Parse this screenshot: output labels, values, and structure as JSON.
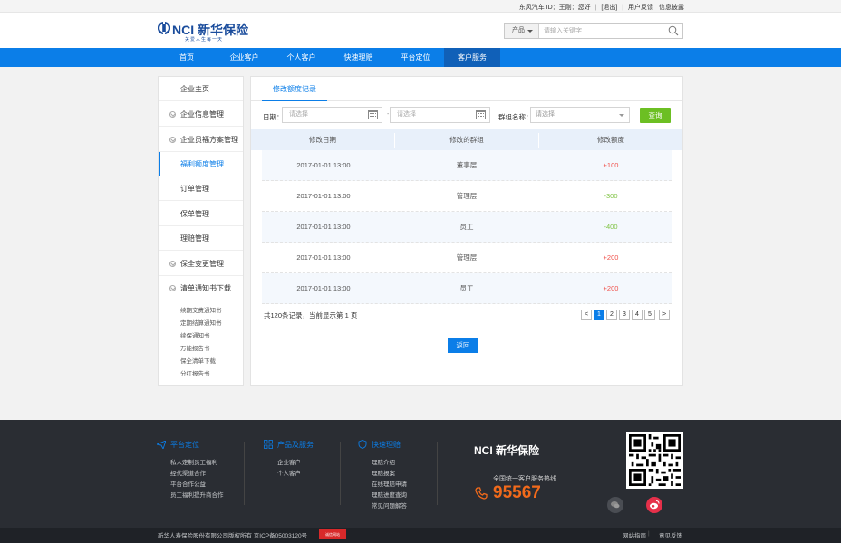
{
  "topbar": {
    "user_greeting": "东风汽车   ID：王刚：您好",
    "logout": "[退出]",
    "feedback": "用户反馈",
    "info_disclosure": "信息披露"
  },
  "header": {
    "logo_text": "NCI 新华保险",
    "logo_slogan": "关爱人生每一天",
    "search": {
      "category": "产品",
      "placeholder": "请输入关键字"
    }
  },
  "nav": {
    "items": [
      "首页",
      "企业客户",
      "个人客户",
      "快速理赔",
      "平台定位",
      "客户服务"
    ],
    "active": "客户服务"
  },
  "sidebar": {
    "items": [
      {
        "label": "企业主页",
        "expandable": false
      },
      {
        "label": "企业信息管理",
        "expandable": true
      },
      {
        "label": "企业员福方案管理",
        "expandable": true
      },
      {
        "label": "福利额度管理",
        "expandable": false,
        "active": true
      },
      {
        "label": "订单管理",
        "expandable": false
      },
      {
        "label": "保单管理",
        "expandable": false
      },
      {
        "label": "理赔管理",
        "expandable": false
      },
      {
        "label": "保全变更管理",
        "expandable": true
      },
      {
        "label": "清单通知书下载",
        "expandable": true
      }
    ],
    "subitems": [
      "续期交费通知书",
      "定期结算通知书",
      "续保通知书",
      "万能报告书",
      "保全清单下载",
      "分红报告书"
    ]
  },
  "panel": {
    "tab": "修改额度记录",
    "filter": {
      "date_label": "日期：",
      "date_start_placeholder": "请选择",
      "date_end_placeholder": "请选择",
      "group_label": "群组名称：",
      "group_placeholder": "请选择",
      "query_button": "查询"
    },
    "table": {
      "headers": [
        "修改日期",
        "修改的群组",
        "修改额度"
      ],
      "rows": [
        {
          "date": "2017-01-01 13:00",
          "group": "董事层",
          "amount": "+100",
          "type": "plus"
        },
        {
          "date": "2017-01-01 13:00",
          "group": "管理层",
          "amount": "-300",
          "type": "minus"
        },
        {
          "date": "2017-01-01 13:00",
          "group": "员工",
          "amount": "-400",
          "type": "minus"
        },
        {
          "date": "2017-01-01 13:00",
          "group": "管理层",
          "amount": "+200",
          "type": "plus"
        },
        {
          "date": "2017-01-01 13:00",
          "group": "员工",
          "amount": "+200",
          "type": "plus"
        }
      ]
    },
    "pager": {
      "info": "共120条记录，当前显示第 1 页",
      "prev": "<",
      "pages": [
        "1",
        "2",
        "3",
        "4",
        "5"
      ],
      "current": "1",
      "next": ">"
    },
    "back_button": "返回"
  },
  "footer": {
    "columns": [
      {
        "title": "平台定位",
        "icon": "send-icon",
        "items": [
          "私人定制员工福利",
          "经代渠道合作",
          "平台合作公益",
          "员工福利提升商合作"
        ]
      },
      {
        "title": "产品及服务",
        "icon": "grid-icon",
        "items": [
          "企业客户",
          "个人客户"
        ]
      },
      {
        "title": "快速理赔",
        "icon": "shield-icon",
        "items": [
          "理赔介绍",
          "理赔报案",
          "在线理赔申请",
          "理赔进度查询",
          "常见问题解答"
        ]
      }
    ],
    "logo_text": "NCI 新华保险",
    "hotline_label": "全国统一客户服务热线",
    "hotline": "95567",
    "copyright": "新华人寿保险股份有限公司版权所有  京ICP备05003120号",
    "badge": "诚信网站",
    "links": [
      "网站指南",
      "意见反馈"
    ]
  },
  "colors": {
    "primary": "#0b7ee8",
    "nav_active": "#1060b8",
    "query_green": "#6cbf23",
    "plus_red": "#f0504a",
    "minus_green": "#7fc343",
    "hotline_orange": "#f26a1b",
    "footer_bg": "#2a2d33"
  }
}
